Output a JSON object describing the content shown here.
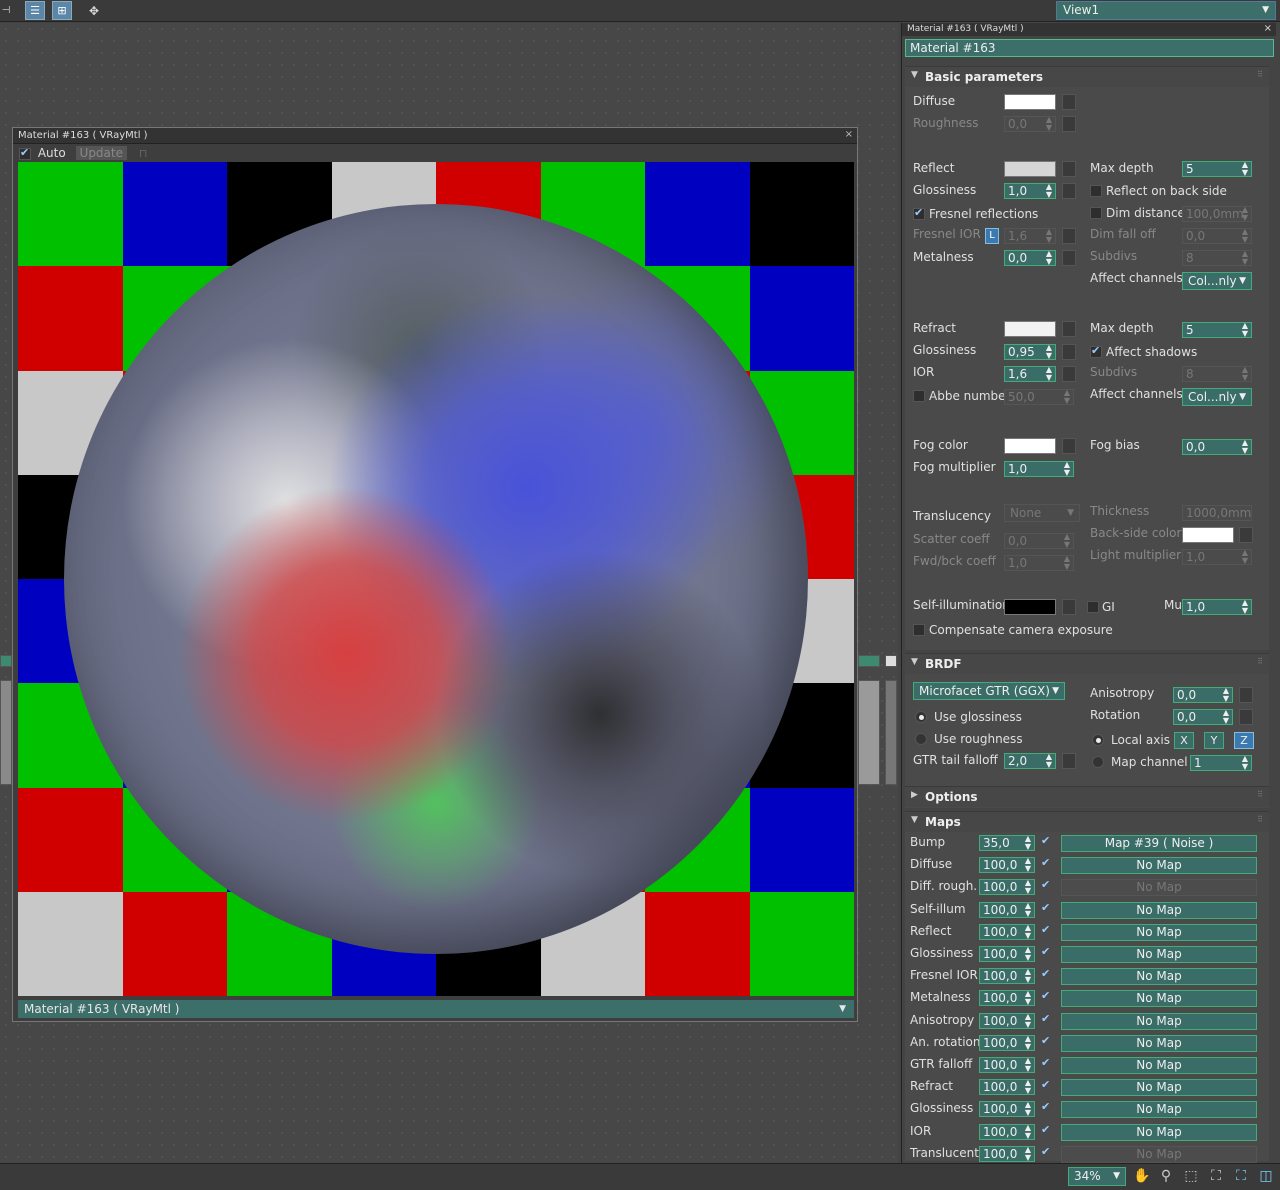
{
  "toolbar": {
    "view_select": "View1"
  },
  "preview": {
    "title": "Material #163  ( VRayMtl )",
    "auto_label": "Auto",
    "update_label": "Update",
    "footer_label": "Material #163  ( VRayMtl )"
  },
  "checker_colors": [
    "#00c000",
    "#0000c0",
    "#000000",
    "#c8c8c8",
    "#d00000",
    "#00c000",
    "#0000c0",
    "#000000",
    "#d00000",
    "#00c000",
    "#00c000",
    "#0000c0",
    "#c8c8c8",
    "#00c000",
    "#00c000",
    "#0000c0",
    "#c8c8c8",
    "#d00000",
    "#00c000",
    "#c8c8c8",
    "#0000c0",
    "#000000",
    "#d00000",
    "#00c000",
    "#000000",
    "#c8c8c8",
    "#d00000",
    "#00c000",
    "#0000c0",
    "#00c000",
    "#000000",
    "#d00000",
    "#0000c0",
    "#000000",
    "#c8c8c8",
    "#d00000",
    "#00c000",
    "#0000c0",
    "#d00000",
    "#c8c8c8",
    "#00c000",
    "#0000c0",
    "#000000",
    "#c8c8c8",
    "#d00000",
    "#c8c8c8",
    "#0000c0",
    "#000000",
    "#d00000",
    "#00c000",
    "#0000c0",
    "#000000",
    "#c8c8c8",
    "#d00000",
    "#00c000",
    "#0000c0",
    "#c8c8c8",
    "#d00000",
    "#00c000",
    "#0000c0",
    "#000000",
    "#c8c8c8",
    "#d00000",
    "#00c000"
  ],
  "panel": {
    "title": "Material #163  ( VRayMtl )",
    "material_name": "Material #163",
    "basic": {
      "header": "Basic parameters",
      "diffuse": "Diffuse",
      "roughness": "Roughness",
      "roughness_val": "0,0",
      "reflect": "Reflect",
      "glossiness": "Glossiness",
      "glossiness_val": "1,0",
      "fresnel_refl": "Fresnel reflections",
      "fresnel_ior": "Fresnel IOR",
      "fresnel_ior_val": "1,6",
      "l_btn": "L",
      "metalness": "Metalness",
      "metalness_val": "0,0",
      "max_depth": "Max depth",
      "max_depth_val": "5",
      "reflect_back": "Reflect on back side",
      "dim_distance": "Dim distance",
      "dim_distance_val": "100,0mm",
      "dim_falloff": "Dim fall off",
      "dim_falloff_val": "0,0",
      "subdivs": "Subdivs",
      "subdivs_val": "8",
      "affect_channels": "Affect channels",
      "affect_channels_val": "Col...nly",
      "refract": "Refract",
      "r_glossiness": "Glossiness",
      "r_glossiness_val": "0,95",
      "ior": "IOR",
      "ior_val": "1,6",
      "abbe": "Abbe number",
      "abbe_val": "50,0",
      "r_max_depth": "Max depth",
      "r_max_depth_val": "5",
      "affect_shadows": "Affect shadows",
      "r_subdivs": "Subdivs",
      "r_subdivs_val": "8",
      "r_affect_channels": "Affect channels",
      "r_affect_channels_val": "Col...nly",
      "fog_color": "Fog color",
      "fog_mult": "Fog multiplier",
      "fog_mult_val": "1,0",
      "fog_bias": "Fog bias",
      "fog_bias_val": "0,0",
      "translucency": "Translucency",
      "translucency_val": "None",
      "scatter": "Scatter coeff",
      "scatter_val": "0,0",
      "fwdbck": "Fwd/bck coeff",
      "fwdbck_val": "1,0",
      "thickness": "Thickness",
      "thickness_val": "1000,0mm",
      "backside_color": "Back-side color",
      "light_mult": "Light multiplier",
      "light_mult_val": "1,0",
      "self_illum": "Self-illumination",
      "gi": "GI",
      "mult": "Mult",
      "mult_val": "1,0",
      "compensate": "Compensate camera exposure"
    },
    "brdf": {
      "header": "BRDF",
      "type": "Microfacet GTR (GGX)",
      "use_gloss": "Use glossiness",
      "use_rough": "Use roughness",
      "gtr_tail": "GTR tail falloff",
      "gtr_tail_val": "2,0",
      "anisotropy": "Anisotropy",
      "anisotropy_val": "0,0",
      "rotation": "Rotation",
      "rotation_val": "0,0",
      "local_axis": "Local axis",
      "x": "X",
      "y": "Y",
      "z": "Z",
      "map_channel": "Map channel",
      "map_channel_val": "1"
    },
    "options": {
      "header": "Options"
    },
    "maps": {
      "header": "Maps",
      "rows": [
        {
          "name": "Bump",
          "val": "35,0",
          "map": "Map #39  ( Noise )",
          "dim": false
        },
        {
          "name": "Diffuse",
          "val": "100,0",
          "map": "No Map",
          "dim": false
        },
        {
          "name": "Diff. rough.",
          "val": "100,0",
          "map": "No Map",
          "dim": true
        },
        {
          "name": "Self-illum",
          "val": "100,0",
          "map": "No Map",
          "dim": false
        },
        {
          "name": "Reflect",
          "val": "100,0",
          "map": "No Map",
          "dim": false
        },
        {
          "name": "Glossiness",
          "val": "100,0",
          "map": "No Map",
          "dim": false
        },
        {
          "name": "Fresnel IOR",
          "val": "100,0",
          "map": "No Map",
          "dim": false
        },
        {
          "name": "Metalness",
          "val": "100,0",
          "map": "No Map",
          "dim": false
        },
        {
          "name": "Anisotropy",
          "val": "100,0",
          "map": "No Map",
          "dim": false
        },
        {
          "name": "An. rotation",
          "val": "100,0",
          "map": "No Map",
          "dim": false
        },
        {
          "name": "GTR falloff",
          "val": "100,0",
          "map": "No Map",
          "dim": false
        },
        {
          "name": "Refract",
          "val": "100,0",
          "map": "No Map",
          "dim": false
        },
        {
          "name": "Glossiness",
          "val": "100,0",
          "map": "No Map",
          "dim": false
        },
        {
          "name": "IOR",
          "val": "100,0",
          "map": "No Map",
          "dim": false
        },
        {
          "name": "Translucent",
          "val": "100,0",
          "map": "No Map",
          "dim": true
        }
      ]
    }
  },
  "statusbar": {
    "zoom": "34%"
  }
}
